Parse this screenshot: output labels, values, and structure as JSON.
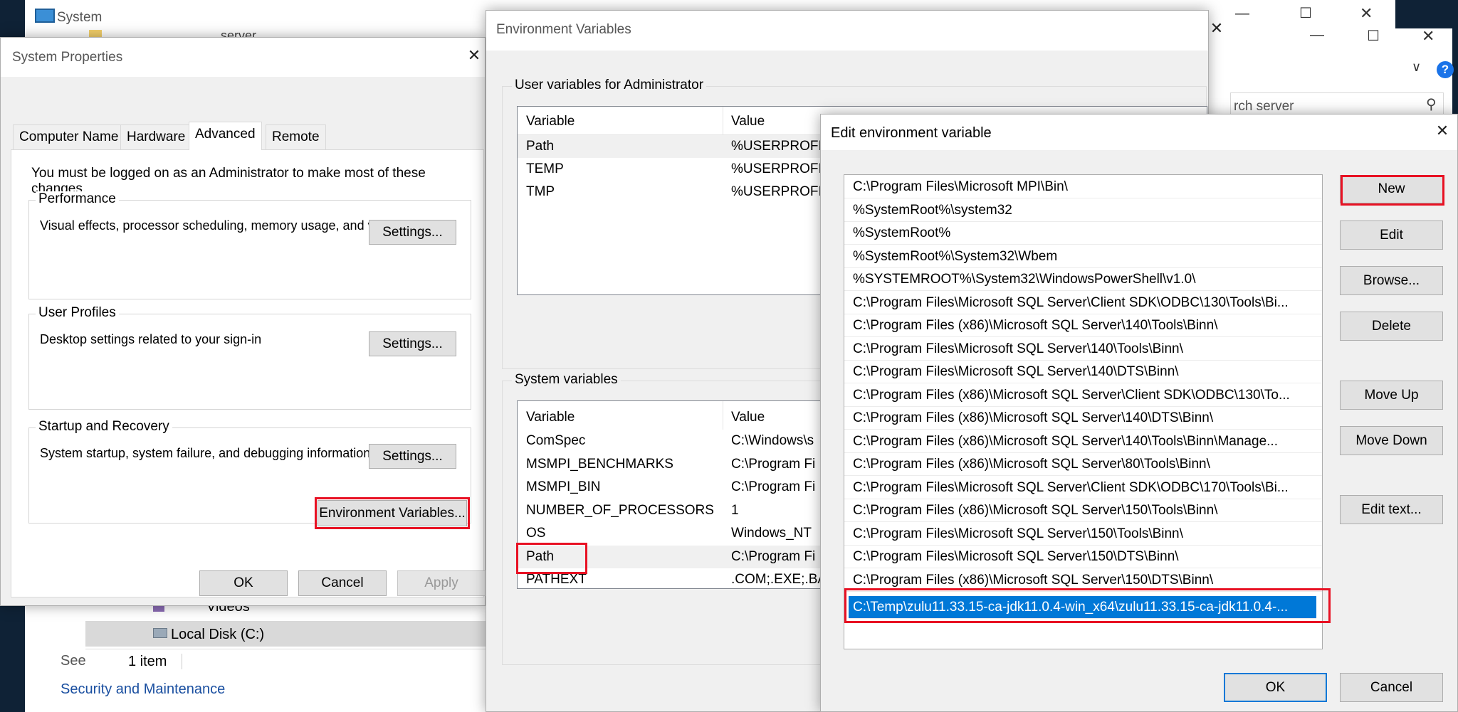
{
  "explorer": {
    "title": "System",
    "path_fragment": "server",
    "search_placeholder": "rch server",
    "nav_videos": "Videos",
    "nav_local_disk": "Local Disk (C:)",
    "status_items": "1 item",
    "see_also_fragment": "See",
    "link_security": "Security and Maintenance"
  },
  "system_properties": {
    "title": "System Properties",
    "tabs": [
      "Computer Name",
      "Hardware",
      "Advanced",
      "Remote"
    ],
    "note": "You must be logged on as an Administrator to make most of these changes.",
    "performance": {
      "label": "Performance",
      "desc": "Visual effects, processor scheduling, memory usage, and virtual memory",
      "button": "Settings..."
    },
    "user_profiles": {
      "label": "User Profiles",
      "desc": "Desktop settings related to your sign-in",
      "button": "Settings..."
    },
    "startup": {
      "label": "Startup and Recovery",
      "desc": "System startup, system failure, and debugging information",
      "button": "Settings..."
    },
    "env_button": "Environment Variables...",
    "ok": "OK",
    "cancel": "Cancel",
    "apply": "Apply"
  },
  "env_vars": {
    "title": "Environment Variables",
    "user_group": "User variables for Administrator",
    "system_group": "System variables",
    "col_variable": "Variable",
    "col_value": "Value",
    "user_rows": [
      {
        "name": "Path",
        "value": "%USERPROFIL"
      },
      {
        "name": "TEMP",
        "value": "%USERPROFIL"
      },
      {
        "name": "TMP",
        "value": "%USERPROFIL"
      }
    ],
    "system_rows": [
      {
        "name": "ComSpec",
        "value": "C:\\Windows\\s"
      },
      {
        "name": "MSMPI_BENCHMARKS",
        "value": "C:\\Program Fi"
      },
      {
        "name": "MSMPI_BIN",
        "value": "C:\\Program Fi"
      },
      {
        "name": "NUMBER_OF_PROCESSORS",
        "value": "1"
      },
      {
        "name": "OS",
        "value": "Windows_NT"
      },
      {
        "name": "Path",
        "value": "C:\\Program Fi"
      },
      {
        "name": "PATHEXT",
        "value": ".COM;.EXE;.BA"
      }
    ]
  },
  "edit_env": {
    "title": "Edit environment variable",
    "entries": [
      "C:\\Program Files\\Microsoft MPI\\Bin\\",
      "%SystemRoot%\\system32",
      "%SystemRoot%",
      "%SystemRoot%\\System32\\Wbem",
      "%SYSTEMROOT%\\System32\\WindowsPowerShell\\v1.0\\",
      "C:\\Program Files\\Microsoft SQL Server\\Client SDK\\ODBC\\130\\Tools\\Bi...",
      "C:\\Program Files (x86)\\Microsoft SQL Server\\140\\Tools\\Binn\\",
      "C:\\Program Files\\Microsoft SQL Server\\140\\Tools\\Binn\\",
      "C:\\Program Files\\Microsoft SQL Server\\140\\DTS\\Binn\\",
      "C:\\Program Files (x86)\\Microsoft SQL Server\\Client SDK\\ODBC\\130\\To...",
      "C:\\Program Files (x86)\\Microsoft SQL Server\\140\\DTS\\Binn\\",
      "C:\\Program Files (x86)\\Microsoft SQL Server\\140\\Tools\\Binn\\Manage...",
      "C:\\Program Files (x86)\\Microsoft SQL Server\\80\\Tools\\Binn\\",
      "C:\\Program Files\\Microsoft SQL Server\\Client SDK\\ODBC\\170\\Tools\\Bi...",
      "C:\\Program Files (x86)\\Microsoft SQL Server\\150\\Tools\\Binn\\",
      "C:\\Program Files\\Microsoft SQL Server\\150\\Tools\\Binn\\",
      "C:\\Program Files\\Microsoft SQL Server\\150\\DTS\\Binn\\",
      "C:\\Program Files (x86)\\Microsoft SQL Server\\150\\DTS\\Binn\\",
      "C:\\Temp\\zulu11.33.15-ca-jdk11.0.4-win_x64\\zulu11.33.15-ca-jdk11.0.4-..."
    ],
    "buttons": {
      "new": "New",
      "edit": "Edit",
      "browse": "Browse...",
      "delete": "Delete",
      "move_up": "Move Up",
      "move_down": "Move Down",
      "edit_text": "Edit text...",
      "ok": "OK",
      "cancel": "Cancel"
    }
  },
  "colors": {
    "selection": "#0078d7",
    "highlight_box": "#e81123",
    "help_icon": "#1a73e8"
  }
}
